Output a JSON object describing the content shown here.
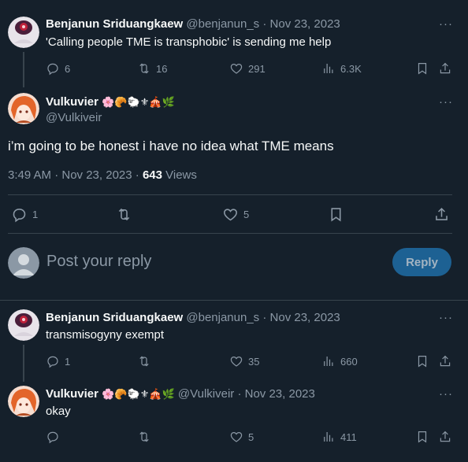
{
  "tweet1": {
    "name": "Benjanun Sriduangkaew",
    "handle": "@benjanun_s",
    "date": "Nov 23, 2023",
    "text": "'Calling people TME is transphobic' is sending me help",
    "replies": "6",
    "retweets": "16",
    "likes": "291",
    "views": "6.3K"
  },
  "main": {
    "name": "Vulkuvier",
    "emojis": "🌸🥐🐑⚜🎪🌿",
    "handle": "@Vulkiveir",
    "text": "i’m going to be honest i have no idea what TME means",
    "time": "3:49 AM · Nov 23, 2023 ·",
    "views_count": "643",
    "views_label": "Views",
    "replies": "1",
    "likes": "5"
  },
  "composer": {
    "placeholder": "Post your reply",
    "button": "Reply"
  },
  "tweet3": {
    "name": "Benjanun Sriduangkaew",
    "handle": "@benjanun_s",
    "date": "Nov 23, 2023",
    "text": "transmisogyny exempt",
    "replies": "1",
    "likes": "35",
    "views": "660"
  },
  "tweet4": {
    "name": "Vulkuvier",
    "emojis": "🌸🥐🐑⚜🎪🌿",
    "handle": "@Vulkiveir",
    "date": "Nov 23, 2023",
    "text": "okay",
    "likes": "5",
    "views": "411"
  },
  "misc": {
    "dot": "·",
    "more": "···"
  },
  "colors": {
    "bg": "#15202b",
    "text": "#f7f9f9",
    "muted": "#8b98a5",
    "divider": "#38444d",
    "reply_button": "#1d6193"
  }
}
